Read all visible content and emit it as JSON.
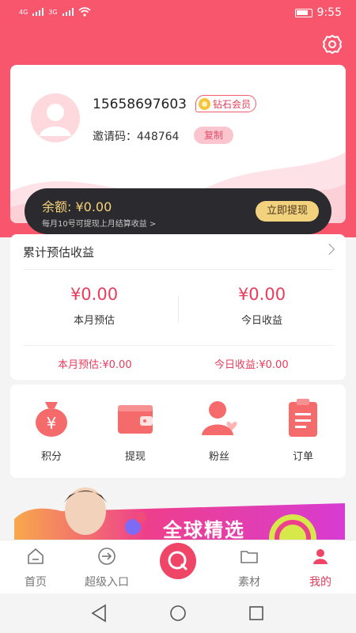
{
  "status_bar": {
    "signal_left": "4G",
    "signal_right": "3G",
    "time": "9:55"
  },
  "profile": {
    "phone": "15658697603",
    "member_level": "钻石会员",
    "invite_label": "邀请码：",
    "invite_code": "448764",
    "copy_label": "复制"
  },
  "balance": {
    "label": "余额: ¥0.00",
    "note": "每月10号可提现上月结算收益 >",
    "withdraw_label": "立即提现"
  },
  "earnings": {
    "title": "累计预估收益",
    "month_value": "¥0.00",
    "month_label": "本月预估",
    "today_value": "¥0.00",
    "today_label": "今日收益",
    "month_summary": "本月预估:¥0.00",
    "today_summary": "今日收益:¥0.00"
  },
  "shortcuts": [
    {
      "label": "积分",
      "icon": "money-bag-icon"
    },
    {
      "label": "提现",
      "icon": "wallet-icon"
    },
    {
      "label": "粉丝",
      "icon": "fans-icon"
    },
    {
      "label": "订单",
      "icon": "order-icon"
    }
  ],
  "banner": {
    "text": "全球精选"
  },
  "tabbar": [
    {
      "label": "首页",
      "icon": "home-icon"
    },
    {
      "label": "超级入口",
      "icon": "entry-icon"
    },
    {
      "label": "",
      "icon": "search-icon"
    },
    {
      "label": "素材",
      "icon": "folder-icon"
    },
    {
      "label": "我的",
      "icon": "profile-icon",
      "active": true
    }
  ],
  "colors": {
    "brand": "#f7566d",
    "accent_red": "#ea3c5b",
    "gold": "#f7d37a",
    "dark_bar": "#2a2a2f"
  }
}
